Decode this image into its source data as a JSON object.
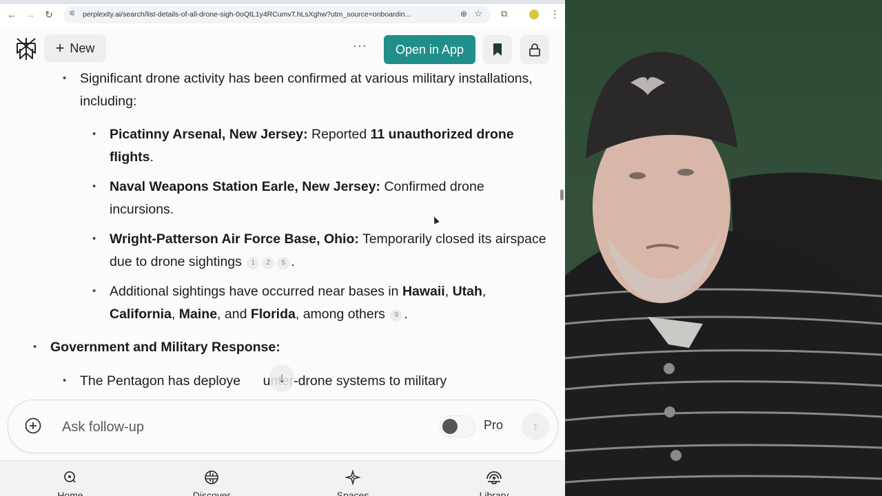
{
  "browser": {
    "url": "perplexity.ai/search/list-details-of-all-drone-sigh-0oQtL1y4RCumvT.hLsXghw?utm_source=onboardin...",
    "icons": {
      "back": "back-arrow-icon",
      "forward": "forward-arrow-icon",
      "reload": "reload-icon",
      "site_settings": "tune-icon",
      "zoom": "zoom-icon",
      "bookmark_star": "star-icon",
      "extensions": "puzzle-icon",
      "profile": "profile-avatar",
      "menu": "kebab-menu-icon"
    }
  },
  "header": {
    "new_label": "New",
    "more_label": "···",
    "open_in_app_label": "Open in App",
    "accent_color": "#208e8a"
  },
  "content": {
    "item1": {
      "text": "Significant drone activity has been confirmed at various military installations, including:"
    },
    "sub1": {
      "bold": "Picatinny Arsenal, New Jersey:",
      "pre": " Reported ",
      "bold2": "11 unauthorized drone flights",
      "post": "."
    },
    "sub2": {
      "bold": "Naval Weapons Station Earle, New Jersey:",
      "text": " Confirmed drone incursions."
    },
    "sub3": {
      "bold": "Wright-Patterson Air Force Base, Ohio:",
      "text": " Temporarily closed its airspace due to drone sightings",
      "citations": [
        "1",
        "2",
        "5"
      ],
      "post": "."
    },
    "sub4": {
      "pre": "Additional sightings have occurred near bases in ",
      "s1": "Hawaii",
      "s2": "Utah",
      "s3": "California",
      "s4": "Maine",
      "s5": "Florida",
      "comma": ", ",
      "and": ", and ",
      "post_text": ", among others",
      "citations": [
        "9"
      ],
      "post": "."
    },
    "section2": {
      "heading": "Government and Military Response:"
    },
    "item2": {
      "text_a": "The Pentagon has deploye",
      "text_b": "unter-drone systems to military"
    }
  },
  "follow_up": {
    "placeholder": "Ask follow-up",
    "pro_label": "Pro",
    "pro_enabled": false
  },
  "bottom_nav": [
    {
      "label": "Home",
      "icon": "home-search-icon"
    },
    {
      "label": "Discover",
      "icon": "globe-icon"
    },
    {
      "label": "Spaces",
      "icon": "sparkle-icon"
    },
    {
      "label": "Library",
      "icon": "library-icon"
    }
  ],
  "webcam": {
    "description": "presenter webcam feed"
  }
}
